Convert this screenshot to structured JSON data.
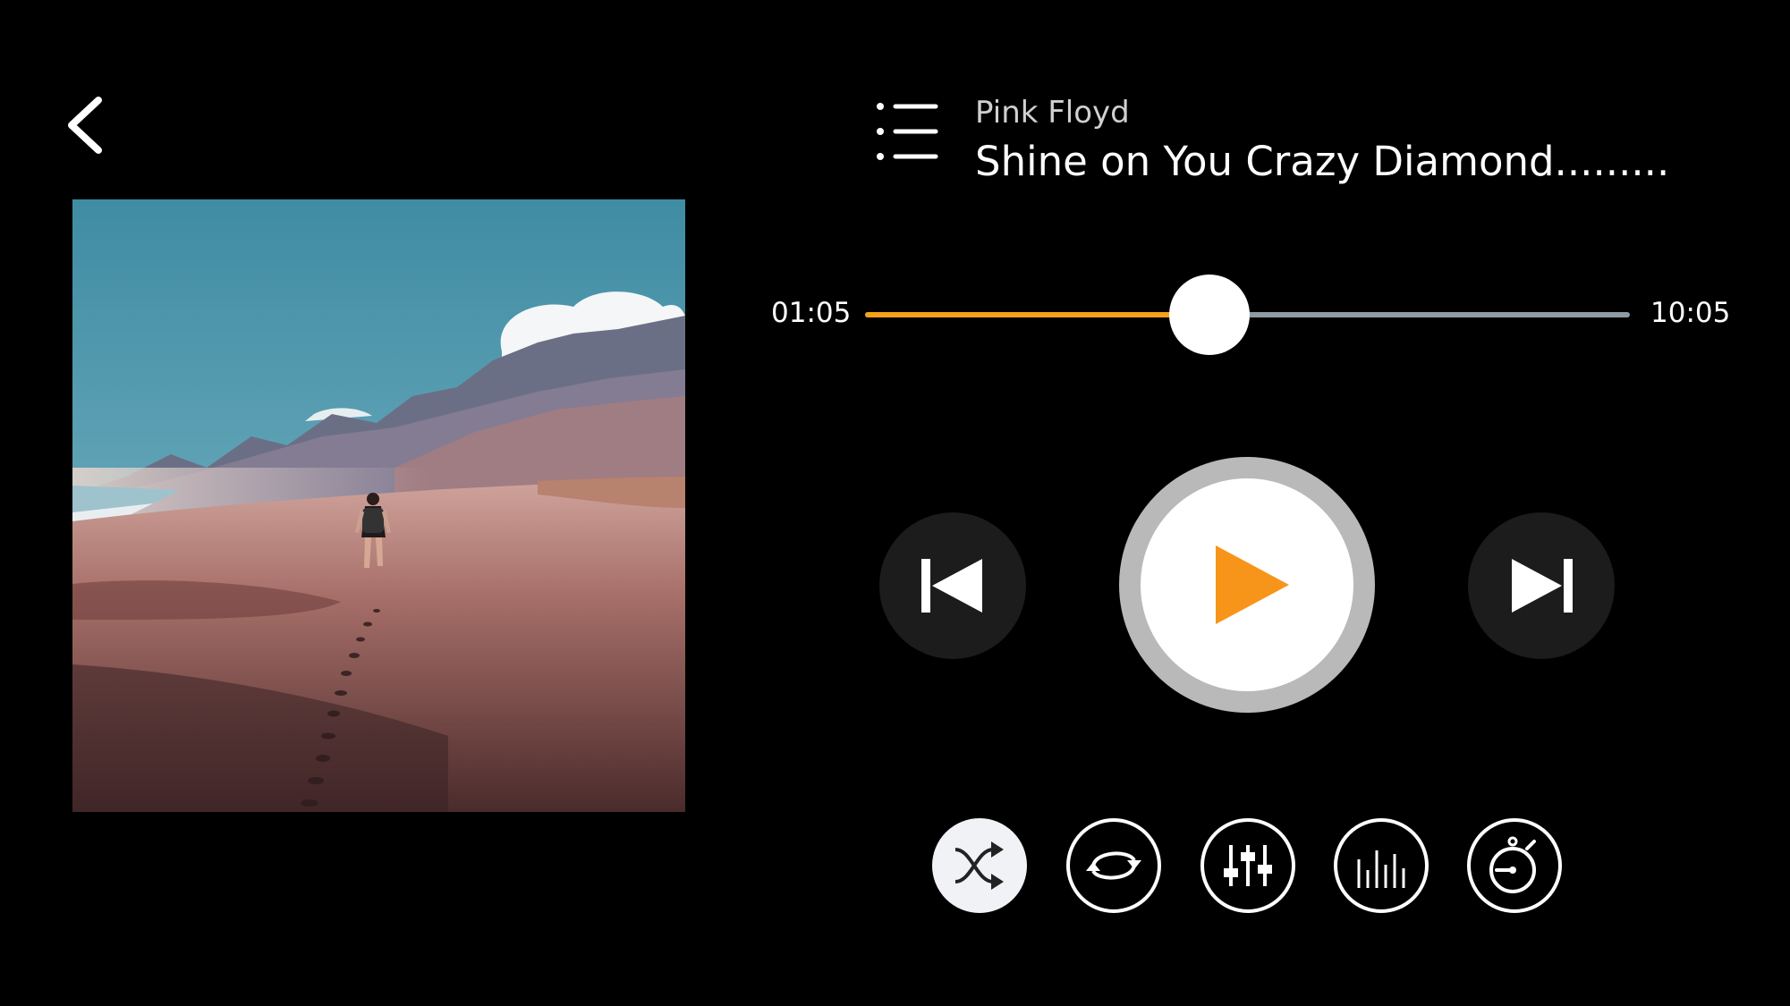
{
  "track": {
    "artist": "Pink Floyd",
    "title": "Shine on You Crazy Diamond........."
  },
  "progress": {
    "elapsed": "01:05",
    "total": "10:05",
    "fraction": 0.45
  },
  "colors": {
    "background": "#000000",
    "accent": "#f5a219",
    "track_remaining": "#8f9aa3",
    "button_dark": "#1c1c1c",
    "play_ring": "#b9b9b9"
  },
  "controls": {
    "back": "chevron-left-icon",
    "playlist": "list-icon",
    "previous": "skip-previous-icon",
    "play": "play-icon",
    "next": "skip-next-icon"
  },
  "options": [
    {
      "name": "shuffle",
      "icon": "shuffle-icon",
      "active": true
    },
    {
      "name": "repeat",
      "icon": "repeat-icon",
      "active": false
    },
    {
      "name": "equalizer",
      "icon": "equalizer-icon",
      "active": false
    },
    {
      "name": "visualizer",
      "icon": "bars-icon",
      "active": false
    },
    {
      "name": "sleep-timer",
      "icon": "stopwatch-icon",
      "active": false
    }
  ],
  "album_art": {
    "icon": "album-cover-image"
  }
}
